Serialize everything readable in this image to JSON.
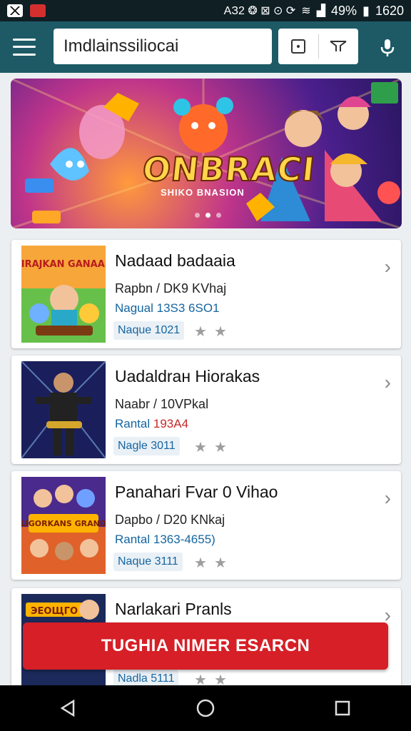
{
  "status_bar": {
    "right_text": "ΑЗ2 ❂ ⊠ ⊙ ⟳",
    "battery": "49%",
    "time": "1620"
  },
  "toolbar": {
    "search_value": "Imdlainssiliocai"
  },
  "banner": {
    "title": "ONBRACI",
    "subtitle": "SHIKO BNASION"
  },
  "cards": [
    {
      "title": "Nadaad badaaia",
      "size": "Rapbn / DK9 KVhaj",
      "rank_label": "Nagual",
      "rank_value": "13S3 6SO1",
      "badge": "Naque 1021",
      "thumb_text": "SIRAJKAN GANAAN"
    },
    {
      "title": "Uadaldraн Hiorakas",
      "size": "Naabr / 10VPkal",
      "rank_label": "Rantal",
      "rank_value": "193A4",
      "badge": "Nagle 3011",
      "thumb_text": ""
    },
    {
      "title": "Panahari Fvar 0 Vihao",
      "size": "Dapbo / D20 KNkaj",
      "rank_label": "Rantal",
      "rank_value": "1363-4655)",
      "badge": "Naque 3111",
      "thumb_text": "ELIGORKANS GRANDS"
    },
    {
      "title": "Narlakari Pranls",
      "size": "",
      "rank_label": "",
      "rank_value": "",
      "badge": "Nadla 5111",
      "thumb_text": "ЭЕОЩГО"
    }
  ],
  "cta": {
    "label": "TUGHIA NIMER ESARCN"
  },
  "colors": {
    "toolbar": "#1d5a66",
    "cta": "#d61f26",
    "link_blue": "#1565a0"
  }
}
